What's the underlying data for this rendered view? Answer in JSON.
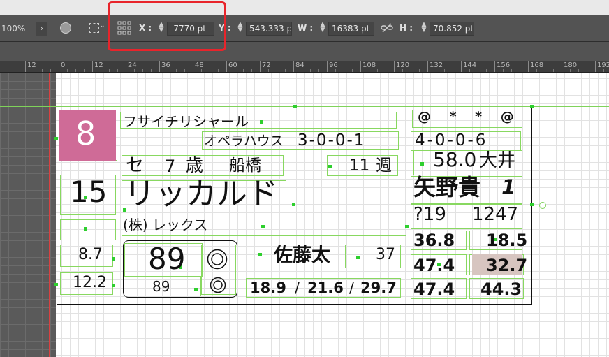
{
  "options_bar": {
    "zoom": "100%",
    "x_label": "X :",
    "x_value": "-7770 pt",
    "y_label": "Y :",
    "y_value": "543.333 pt",
    "w_label": "W :",
    "w_value": "16383 pt",
    "h_label": "H :",
    "h_value": "70.852 pt"
  },
  "ruler": {
    "labels": [
      "12",
      "0",
      "12",
      "24",
      "36",
      "48",
      "60",
      "72",
      "84",
      "96",
      "108",
      "120",
      "132",
      "144",
      "156",
      "168",
      "180",
      "192"
    ]
  },
  "card": {
    "post_number": "8",
    "horse_number": "15",
    "sire": "フサイチリシャール",
    "dam_sire": "オペラハウス",
    "record_left": "3-0-0-1",
    "record_right": "4-0-0-6",
    "marks": "@ * * @",
    "sex": "セ",
    "age": "7",
    "age_unit": "歳",
    "stable": "船橋",
    "weeks": "11",
    "weeks_unit": "週",
    "weight": "58.0",
    "track": "大井",
    "horse_name": "リッカルド",
    "jockey": "矢野貴",
    "jockey_no": "1",
    "owner": "(株) レックス",
    "val_219": "?19",
    "val_1247": "1247",
    "odds_1": "8.7",
    "odds_2": "12.2",
    "rating": "89",
    "rating_small": "89",
    "trainer": "佐藤太",
    "trainer_no": "37",
    "stat_1": "36.8",
    "stat_2": "18.5",
    "stat_3": "47.4",
    "stat_4": "32.7",
    "stat_5": "47.4",
    "stat_6": "44.3",
    "split_1": "18.9",
    "split_2": "21.6",
    "split_3": "29.7",
    "slash": "/",
    "post_color": "#cf6b97",
    "highlight_color": "#d7c5c0"
  }
}
